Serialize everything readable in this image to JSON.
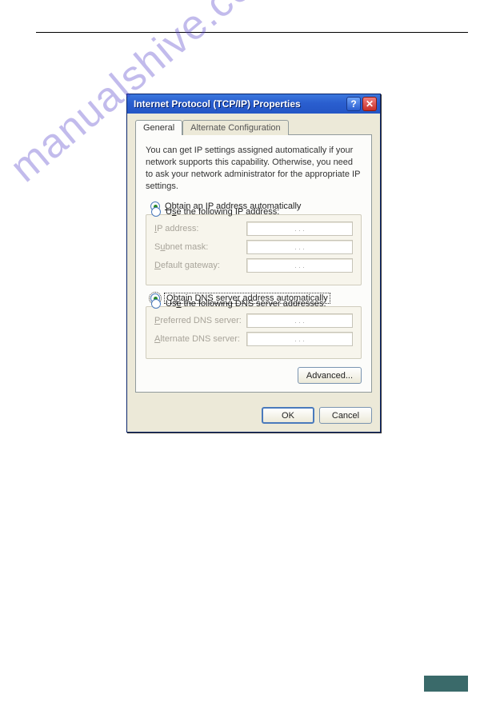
{
  "watermark": "manualshive.com",
  "window": {
    "title": "Internet Protocol (TCP/IP) Properties",
    "help_symbol": "?",
    "close_symbol": "✕"
  },
  "tabs": {
    "general": "General",
    "alt": "Alternate Configuration"
  },
  "description": "You can get IP settings assigned automatically if your network supports this capability. Otherwise, you need to ask your network administrator for the appropriate IP settings.",
  "ip": {
    "auto_label": "Obtain an IP address automatically",
    "manual_label": "Use the following IP address:",
    "fields": {
      "ip_address": "IP address:",
      "subnet": "Subnet mask:",
      "gateway": "Default gateway:"
    }
  },
  "dns": {
    "auto_label": "Obtain DNS server address automatically",
    "manual_label": "Use the following DNS server addresses:",
    "fields": {
      "preferred": "Preferred DNS server:",
      "alternate": "Alternate DNS server:"
    }
  },
  "buttons": {
    "advanced": "Advanced...",
    "ok": "OK",
    "cancel": "Cancel"
  },
  "ip_dots": ".   .   ."
}
